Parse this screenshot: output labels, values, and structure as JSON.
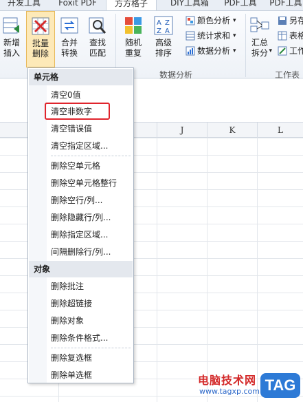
{
  "tabs": [
    {
      "label": "开发工具",
      "active": false
    },
    {
      "label": "Foxit PDF",
      "active": false
    },
    {
      "label": "方方格子",
      "active": true
    },
    {
      "label": "DIY工具箱",
      "active": false
    },
    {
      "label": "PDF工具",
      "active": false
    },
    {
      "label": "PDF工具",
      "active": false
    }
  ],
  "ribbon": {
    "insert": {
      "line1": "新增",
      "line2": "插入"
    },
    "batch_delete": {
      "line1": "批量",
      "line2": "删除"
    },
    "merge": {
      "line1": "合并",
      "line2": "转换"
    },
    "find": {
      "line1": "查找",
      "line2": "匹配"
    },
    "random": {
      "line1": "随机",
      "line2": "重复"
    },
    "sort": {
      "line1": "高级",
      "line2": "排序"
    },
    "color_analysis": "颜色分析",
    "stat_sum": "统计求和",
    "data_analysis": "数据分析",
    "summary": {
      "line1": "汇总",
      "line2": "拆分"
    },
    "save_as": "另存",
    "table": "表格",
    "work": "工作",
    "group_data_analysis": "数据分析",
    "group_worksheet": "工作表"
  },
  "columns": [
    "J",
    "K",
    "L"
  ],
  "menu": {
    "section_cells": "单元格",
    "items_cells": [
      "清空0值",
      "清空非数字",
      "清空错误值",
      "清空指定区域...",
      "删除空单元格",
      "删除空单元格整行",
      "删除空行/列...",
      "删除隐藏行/列...",
      "删除指定区域...",
      "间隔删除行/列..."
    ],
    "section_objects": "对象",
    "items_objects": [
      "删除批注",
      "删除超链接",
      "删除对象",
      "删除条件格式...",
      "删除复选框",
      "删除单选框"
    ]
  },
  "watermark": {
    "line1": "电脑技术网",
    "line2": "www.tagxp.com",
    "tag": "TAG"
  },
  "colors": {
    "highlight": "#e0242c",
    "pressed": "#fde9b8"
  }
}
